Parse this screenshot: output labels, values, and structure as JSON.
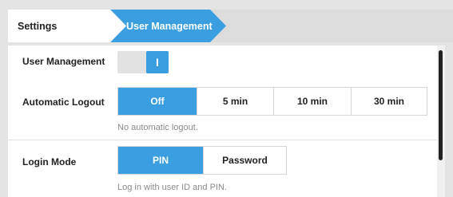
{
  "breadcrumb": {
    "items": [
      {
        "label": "Settings"
      },
      {
        "label": "User Management"
      }
    ]
  },
  "settings": {
    "user_management": {
      "label": "User Management",
      "toggle_glyph": "I",
      "enabled": true
    },
    "automatic_logout": {
      "label": "Automatic Logout",
      "options": [
        "Off",
        "5 min",
        "10 min",
        "30 min"
      ],
      "selected": "Off",
      "helper": "No automatic logout."
    },
    "login_mode": {
      "label": "Login Mode",
      "options": [
        "PIN",
        "Password"
      ],
      "selected": "PIN",
      "helper": "Log in with user ID and PIN."
    }
  },
  "colors": {
    "accent": "#3a9ee0",
    "background": "#e4e4e4",
    "panel": "#ffffff"
  }
}
